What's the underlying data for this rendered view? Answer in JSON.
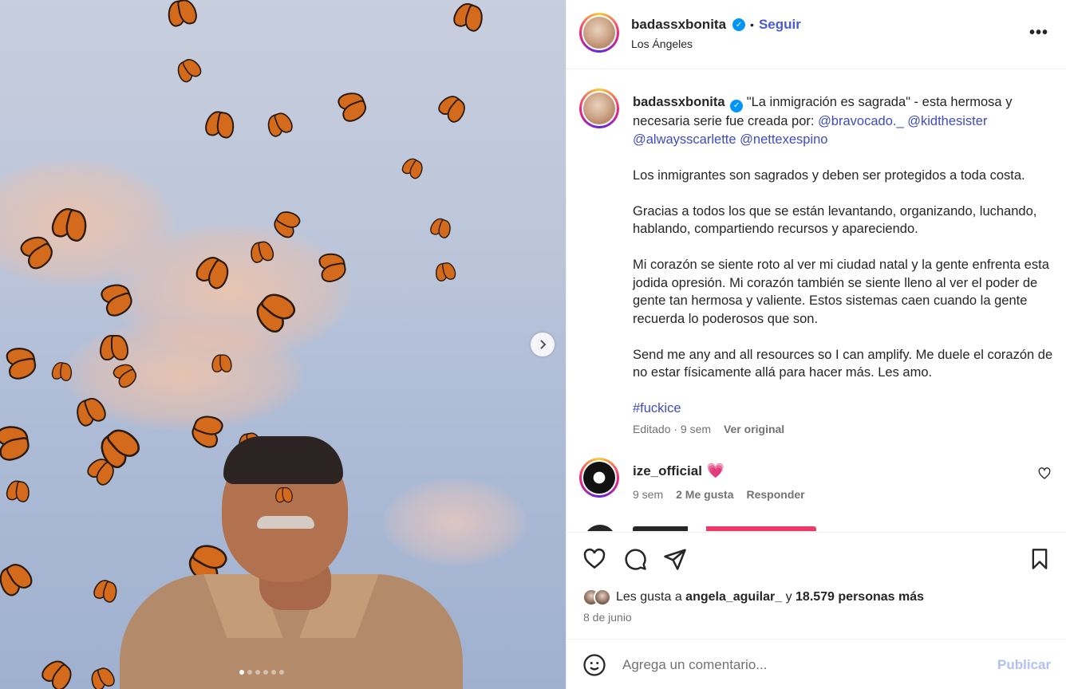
{
  "post": {
    "username": "badassxbonita",
    "verified_icon": "verified-badge-icon",
    "separator": "•",
    "follow_label": "Seguir",
    "location": "Los Ángeles",
    "more_icon": "more-options-icon"
  },
  "media": {
    "next_icon": "chevron-right-icon",
    "slide_count": 6,
    "active_slide": 1
  },
  "caption": {
    "username": "badassxbonita",
    "intro": "\"La inmigración es sagrada\" - esta hermosa y necesaria serie fue creada por: ",
    "mentions": [
      "@bravocado._",
      "@kidthesister",
      "@alwaysscarlette",
      "@nettexespino"
    ],
    "paragraphs": [
      "Los inmigrantes son sagrados y deben ser protegidos a toda costa.",
      "Gracias a todos los que se están levantando, organizando, luchando, hablando, compartiendo recursos y apareciendo.",
      "Mi corazón se siente roto al ver mi ciudad natal y la gente enfrenta esta jodida opresión. Mi corazón también se siente lleno al ver el poder de gente tan hermosa y valiente. Estos sistemas caen cuando la gente recuerda lo poderosos que son.",
      "Send me any and all resources so I can amplify. Me duele el corazón de no estar físicamente allá para hacer más. Les amo."
    ],
    "hashtag": "#fuckice",
    "edited_label": "Editado · 9 sem",
    "see_original": "Ver original"
  },
  "comment": {
    "username": "ize_official",
    "emoji": "💗",
    "time": "9 sem",
    "likes": "2 Me gusta",
    "reply": "Responder",
    "like_icon": "heart-outline-icon"
  },
  "actions": {
    "like_icon": "heart-icon",
    "comment_icon": "comment-icon",
    "share_icon": "send-icon",
    "save_icon": "bookmark-icon",
    "likes_prefix": "Les gusta a ",
    "liked_by": "angela_aguilar_",
    "likes_mid": " y ",
    "likes_count": "18.579 personas más",
    "date": "8 de junio"
  },
  "comment_box": {
    "emoji_icon": "emoji-smile-icon",
    "placeholder": "Agrega un comentario...",
    "post_label": "Publicar"
  },
  "colors": {
    "link": "#3f4cbf",
    "follow": "#4a5bd6",
    "verified": "#0095f6",
    "post_disabled": "#b2c1f3"
  }
}
